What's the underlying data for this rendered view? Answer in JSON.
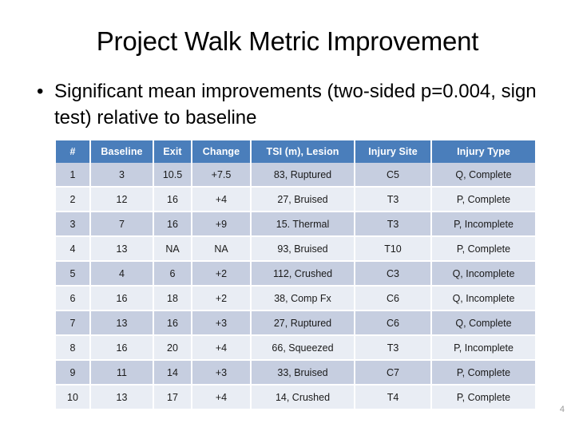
{
  "slide": {
    "title": "Project Walk Metric Improvement",
    "page_number": "4",
    "bullet_marker": "•",
    "bullets": [
      "Significant mean improvements (two-sided p=0.004, sign test) relative to baseline"
    ]
  },
  "colors": {
    "header_fill": "#4A7EBB",
    "header_text": "#FFFFFF",
    "row_odd": "#C6CEE0",
    "row_even": "#E9EDF4",
    "body_text": "#1A1A1A",
    "page_number": "#9A9A9A",
    "background": "#FFFFFF"
  },
  "table": {
    "columns": [
      "#",
      "Baseline",
      "Exit",
      "Change",
      "TSI (m), Lesion",
      "Injury Site",
      "Injury Type"
    ],
    "rows": [
      [
        "1",
        "3",
        "10.5",
        "+7.5",
        "83, Ruptured",
        "C5",
        "Q, Complete"
      ],
      [
        "2",
        "12",
        "16",
        "+4",
        "27, Bruised",
        "T3",
        "P, Complete"
      ],
      [
        "3",
        "7",
        "16",
        "+9",
        "15. Thermal",
        "T3",
        "P, Incomplete"
      ],
      [
        "4",
        "13",
        "NA",
        "NA",
        "93, Bruised",
        "T10",
        "P, Complete"
      ],
      [
        "5",
        "4",
        "6",
        "+2",
        "112, Crushed",
        "C3",
        "Q, Incomplete"
      ],
      [
        "6",
        "16",
        "18",
        "+2",
        "38, Comp Fx",
        "C6",
        "Q, Incomplete"
      ],
      [
        "7",
        "13",
        "16",
        "+3",
        "27, Ruptured",
        "C6",
        "Q, Complete"
      ],
      [
        "8",
        "16",
        "20",
        "+4",
        "66, Squeezed",
        "T3",
        "P, Incomplete"
      ],
      [
        "9",
        "11",
        "14",
        "+3",
        "33, Bruised",
        "C7",
        "P, Complete"
      ],
      [
        "10",
        "13",
        "17",
        "+4",
        "14, Crushed",
        "T4",
        "P, Complete"
      ]
    ]
  }
}
